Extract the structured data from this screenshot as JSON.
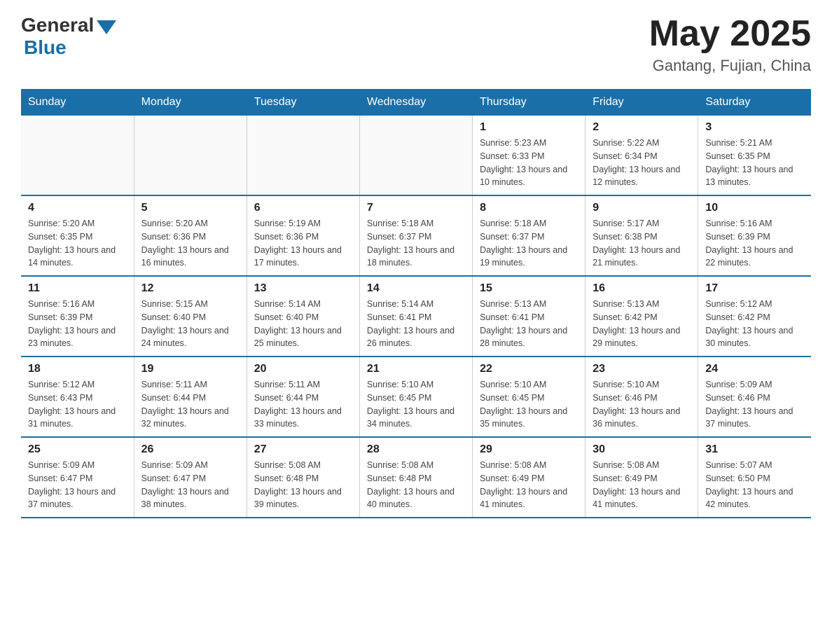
{
  "header": {
    "logo_general": "General",
    "logo_blue": "Blue",
    "month_year": "May 2025",
    "location": "Gantang, Fujian, China"
  },
  "weekdays": [
    "Sunday",
    "Monday",
    "Tuesday",
    "Wednesday",
    "Thursday",
    "Friday",
    "Saturday"
  ],
  "weeks": [
    [
      {
        "day": "",
        "info": ""
      },
      {
        "day": "",
        "info": ""
      },
      {
        "day": "",
        "info": ""
      },
      {
        "day": "",
        "info": ""
      },
      {
        "day": "1",
        "info": "Sunrise: 5:23 AM\nSunset: 6:33 PM\nDaylight: 13 hours and 10 minutes."
      },
      {
        "day": "2",
        "info": "Sunrise: 5:22 AM\nSunset: 6:34 PM\nDaylight: 13 hours and 12 minutes."
      },
      {
        "day": "3",
        "info": "Sunrise: 5:21 AM\nSunset: 6:35 PM\nDaylight: 13 hours and 13 minutes."
      }
    ],
    [
      {
        "day": "4",
        "info": "Sunrise: 5:20 AM\nSunset: 6:35 PM\nDaylight: 13 hours and 14 minutes."
      },
      {
        "day": "5",
        "info": "Sunrise: 5:20 AM\nSunset: 6:36 PM\nDaylight: 13 hours and 16 minutes."
      },
      {
        "day": "6",
        "info": "Sunrise: 5:19 AM\nSunset: 6:36 PM\nDaylight: 13 hours and 17 minutes."
      },
      {
        "day": "7",
        "info": "Sunrise: 5:18 AM\nSunset: 6:37 PM\nDaylight: 13 hours and 18 minutes."
      },
      {
        "day": "8",
        "info": "Sunrise: 5:18 AM\nSunset: 6:37 PM\nDaylight: 13 hours and 19 minutes."
      },
      {
        "day": "9",
        "info": "Sunrise: 5:17 AM\nSunset: 6:38 PM\nDaylight: 13 hours and 21 minutes."
      },
      {
        "day": "10",
        "info": "Sunrise: 5:16 AM\nSunset: 6:39 PM\nDaylight: 13 hours and 22 minutes."
      }
    ],
    [
      {
        "day": "11",
        "info": "Sunrise: 5:16 AM\nSunset: 6:39 PM\nDaylight: 13 hours and 23 minutes."
      },
      {
        "day": "12",
        "info": "Sunrise: 5:15 AM\nSunset: 6:40 PM\nDaylight: 13 hours and 24 minutes."
      },
      {
        "day": "13",
        "info": "Sunrise: 5:14 AM\nSunset: 6:40 PM\nDaylight: 13 hours and 25 minutes."
      },
      {
        "day": "14",
        "info": "Sunrise: 5:14 AM\nSunset: 6:41 PM\nDaylight: 13 hours and 26 minutes."
      },
      {
        "day": "15",
        "info": "Sunrise: 5:13 AM\nSunset: 6:41 PM\nDaylight: 13 hours and 28 minutes."
      },
      {
        "day": "16",
        "info": "Sunrise: 5:13 AM\nSunset: 6:42 PM\nDaylight: 13 hours and 29 minutes."
      },
      {
        "day": "17",
        "info": "Sunrise: 5:12 AM\nSunset: 6:42 PM\nDaylight: 13 hours and 30 minutes."
      }
    ],
    [
      {
        "day": "18",
        "info": "Sunrise: 5:12 AM\nSunset: 6:43 PM\nDaylight: 13 hours and 31 minutes."
      },
      {
        "day": "19",
        "info": "Sunrise: 5:11 AM\nSunset: 6:44 PM\nDaylight: 13 hours and 32 minutes."
      },
      {
        "day": "20",
        "info": "Sunrise: 5:11 AM\nSunset: 6:44 PM\nDaylight: 13 hours and 33 minutes."
      },
      {
        "day": "21",
        "info": "Sunrise: 5:10 AM\nSunset: 6:45 PM\nDaylight: 13 hours and 34 minutes."
      },
      {
        "day": "22",
        "info": "Sunrise: 5:10 AM\nSunset: 6:45 PM\nDaylight: 13 hours and 35 minutes."
      },
      {
        "day": "23",
        "info": "Sunrise: 5:10 AM\nSunset: 6:46 PM\nDaylight: 13 hours and 36 minutes."
      },
      {
        "day": "24",
        "info": "Sunrise: 5:09 AM\nSunset: 6:46 PM\nDaylight: 13 hours and 37 minutes."
      }
    ],
    [
      {
        "day": "25",
        "info": "Sunrise: 5:09 AM\nSunset: 6:47 PM\nDaylight: 13 hours and 37 minutes."
      },
      {
        "day": "26",
        "info": "Sunrise: 5:09 AM\nSunset: 6:47 PM\nDaylight: 13 hours and 38 minutes."
      },
      {
        "day": "27",
        "info": "Sunrise: 5:08 AM\nSunset: 6:48 PM\nDaylight: 13 hours and 39 minutes."
      },
      {
        "day": "28",
        "info": "Sunrise: 5:08 AM\nSunset: 6:48 PM\nDaylight: 13 hours and 40 minutes."
      },
      {
        "day": "29",
        "info": "Sunrise: 5:08 AM\nSunset: 6:49 PM\nDaylight: 13 hours and 41 minutes."
      },
      {
        "day": "30",
        "info": "Sunrise: 5:08 AM\nSunset: 6:49 PM\nDaylight: 13 hours and 41 minutes."
      },
      {
        "day": "31",
        "info": "Sunrise: 5:07 AM\nSunset: 6:50 PM\nDaylight: 13 hours and 42 minutes."
      }
    ]
  ]
}
